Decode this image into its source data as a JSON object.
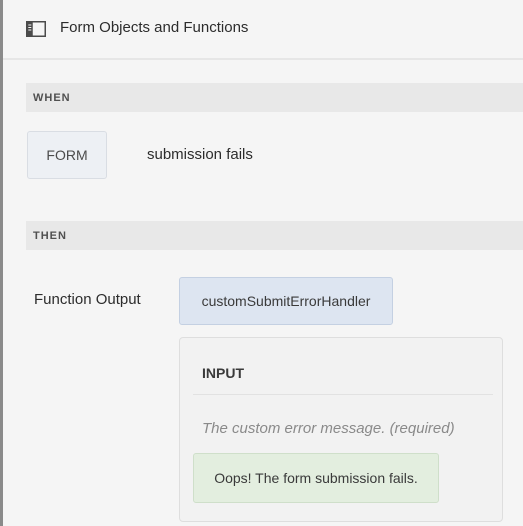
{
  "header": {
    "title": "Form Objects and Functions",
    "icon": "panel-toggle-icon"
  },
  "when": {
    "label": "WHEN",
    "object_label": "FORM",
    "event_label": "submission fails"
  },
  "then": {
    "label": "THEN",
    "action_label": "Function Output",
    "function_name": "customSubmitErrorHandler",
    "input": {
      "heading": "INPUT",
      "hint": "The custom error message. (required)",
      "value": "Oops! The form submission fails."
    }
  },
  "colors": {
    "background": "#f5f5f5",
    "section_bar": "#e8e8e8",
    "form_chip": "#edf0f4",
    "function_chip": "#dde5f1",
    "value_chip": "#e3eedf"
  }
}
